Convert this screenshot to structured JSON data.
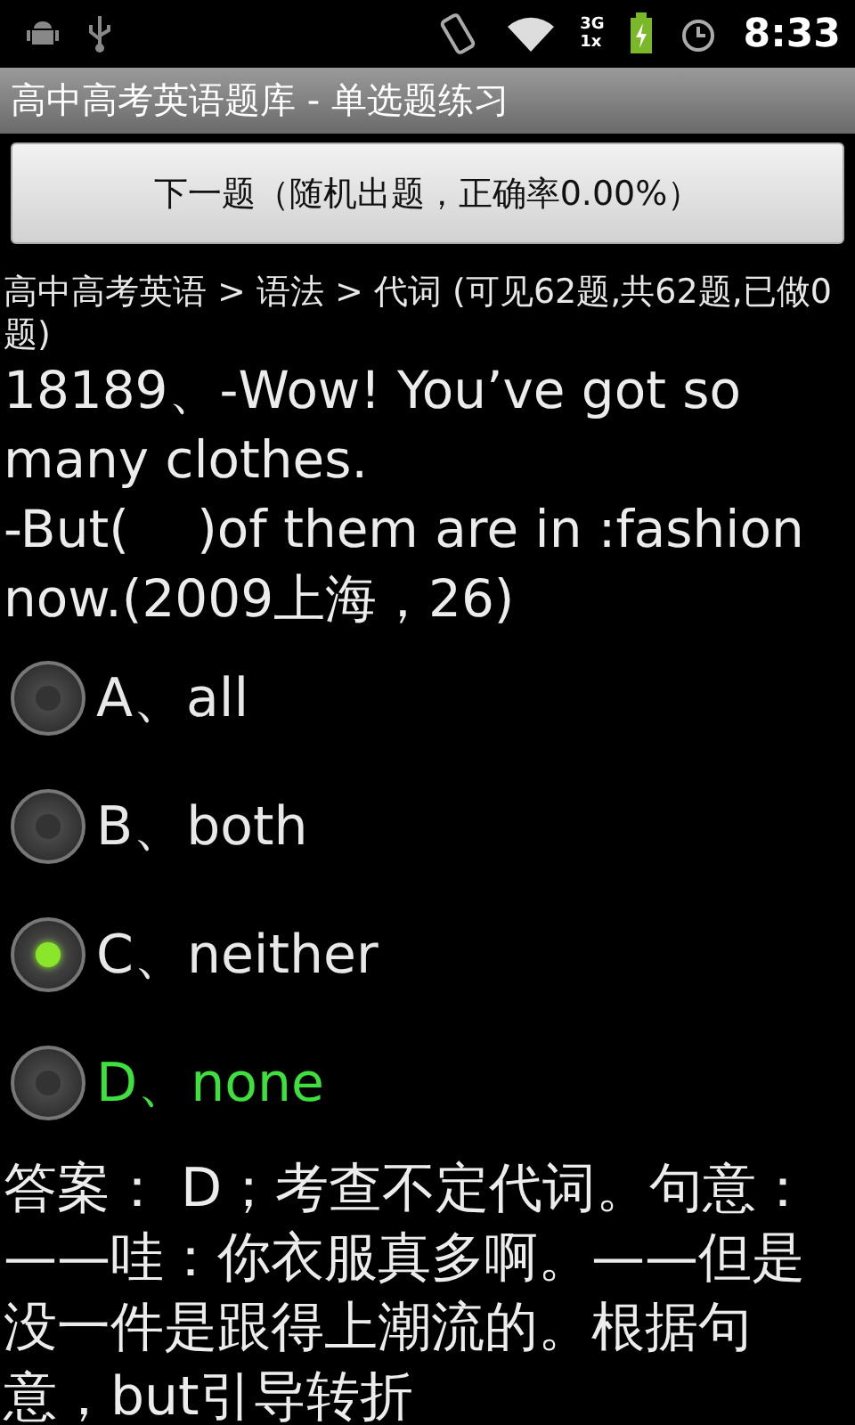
{
  "status_bar": {
    "time": "8:33",
    "network": "3G",
    "network_2": "1x"
  },
  "title": "高中高考英语题库 - 单选题练习",
  "next_button": "下一题（随机出题，正确率0.00%）",
  "breadcrumb": "高中高考英语 > 语法 > 代词 (可见62题,共62题,已做0题)",
  "question": [
    "18189、-Wow! You’ve got so many clothes.",
    "-But(　 )of them are in :fashion now.(2009上海，26)"
  ],
  "options": [
    {
      "label": "A、all",
      "selected": false,
      "correct": false
    },
    {
      "label": "B、both",
      "selected": false,
      "correct": false
    },
    {
      "label": "C、neither",
      "selected": true,
      "correct": false
    },
    {
      "label": "D、none",
      "selected": false,
      "correct": true
    }
  ],
  "answer": "答案： D；考查不定代词。句意：——哇：你衣服真多啊。——但是没一件是跟得上潮流的。根据句意，but引导转折"
}
